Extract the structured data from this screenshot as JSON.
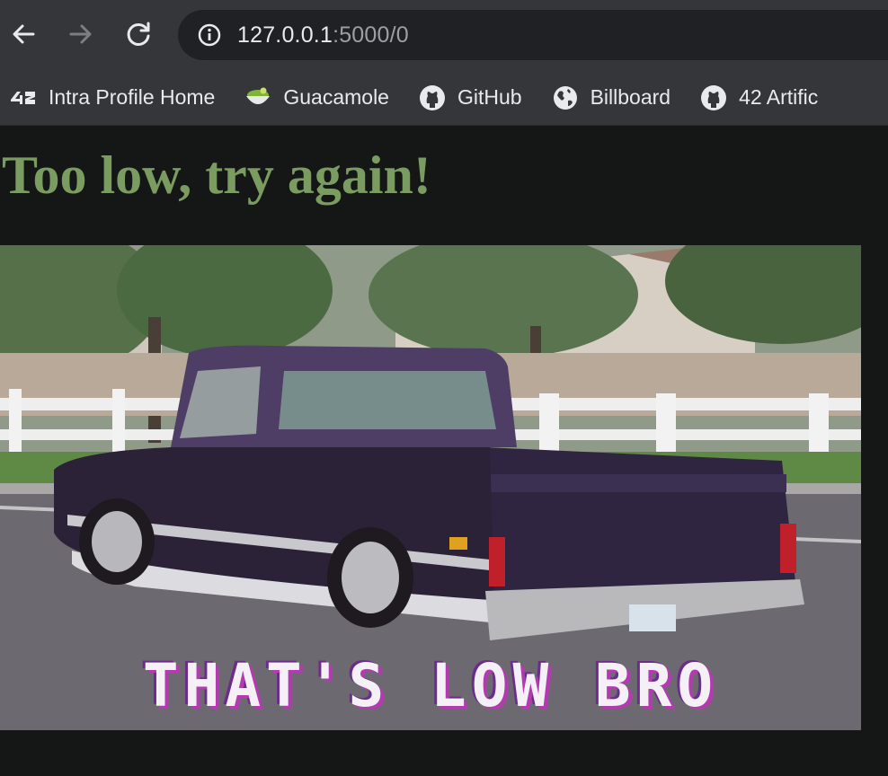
{
  "browser": {
    "url_host": "127.0.0.1",
    "url_rest": ":5000/0",
    "bookmarks": [
      {
        "label": "Intra Profile Home",
        "icon": "42-logo-icon"
      },
      {
        "label": "Guacamole",
        "icon": "guacamole-bowl-icon"
      },
      {
        "label": "GitHub",
        "icon": "github-icon"
      },
      {
        "label": "Billboard",
        "icon": "globe-icon"
      },
      {
        "label": "42 Artific",
        "icon": "github-icon"
      }
    ]
  },
  "page": {
    "heading": "Too low, try again!",
    "heading_color": "#7a9c61",
    "background": "#151716",
    "gif_caption": "THAT'S LOW BRO"
  }
}
